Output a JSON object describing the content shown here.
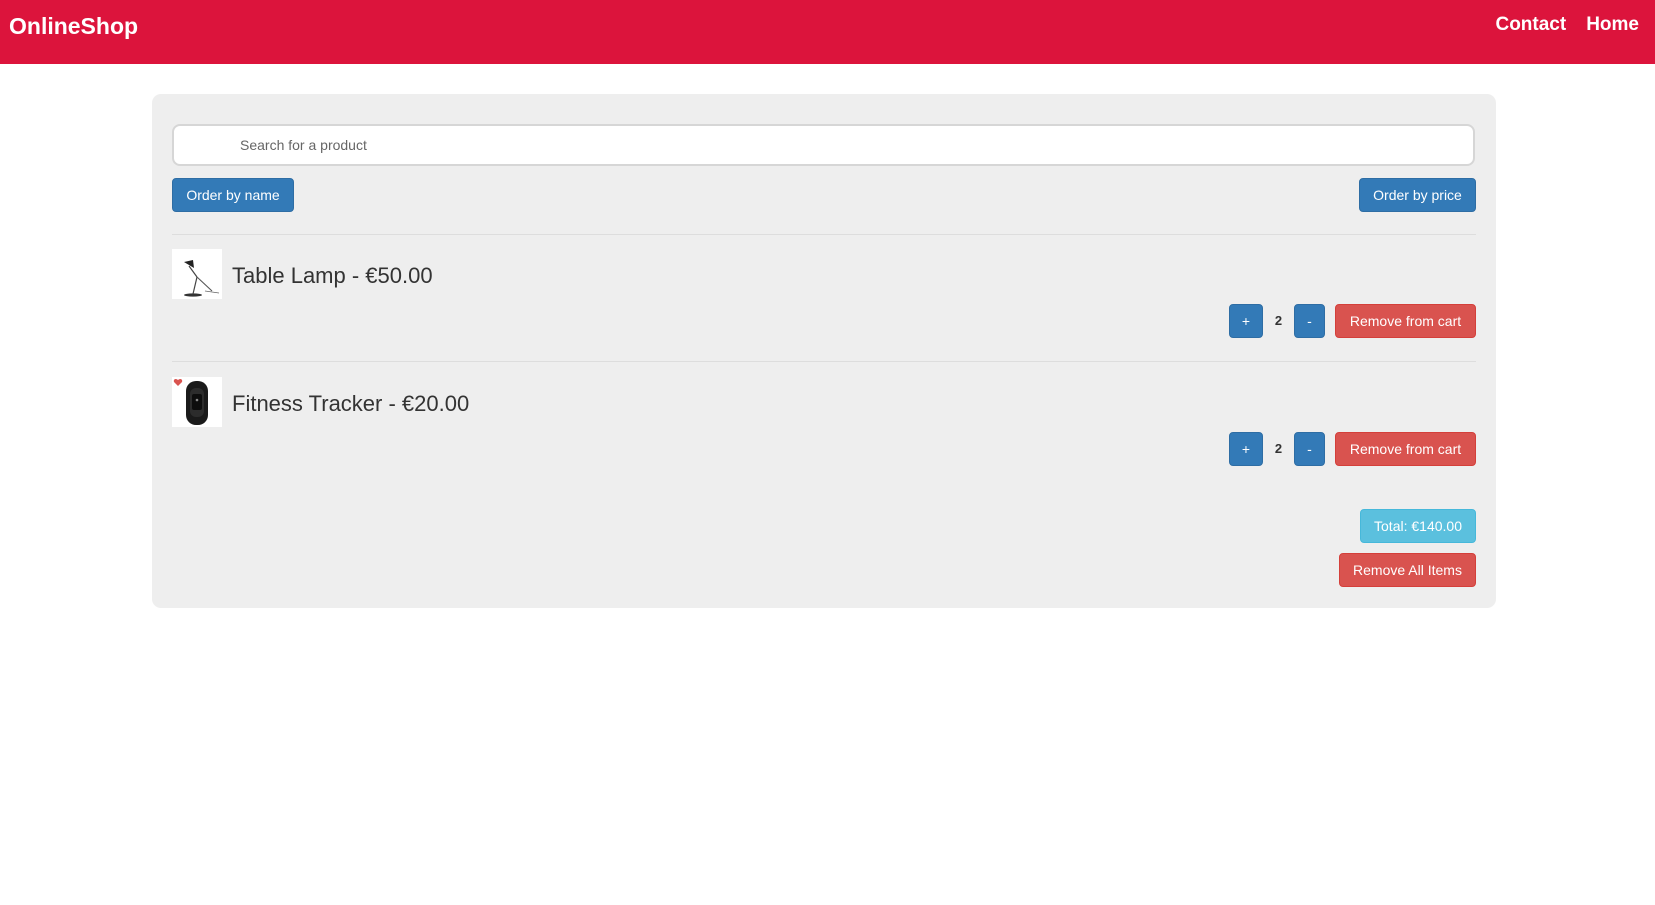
{
  "navbar": {
    "brand": "OnlineShop",
    "links": [
      "Contact",
      "Home"
    ],
    "background": "#dc143c"
  },
  "search": {
    "placeholder": "Search for a product",
    "value": ""
  },
  "sort": {
    "by_name_label": "Order by name",
    "by_price_label": "Order by price"
  },
  "cart": {
    "items": [
      {
        "title": "Table Lamp - €50.00",
        "icon": "table-lamp-image",
        "quantity": "2",
        "plus_label": "+",
        "minus_label": "-",
        "remove_label": "Remove from cart"
      },
      {
        "title": "Fitness Tracker - €20.00",
        "icon": "fitness-tracker-image",
        "quantity": "2",
        "plus_label": "+",
        "minus_label": "-",
        "remove_label": "Remove from cart"
      }
    ],
    "total_label": "Total: €140.00",
    "remove_all_label": "Remove All Items"
  },
  "colors": {
    "primary": "#337ab7",
    "danger": "#d9534f",
    "info": "#5bc0de",
    "panel": "#eeeeee"
  }
}
